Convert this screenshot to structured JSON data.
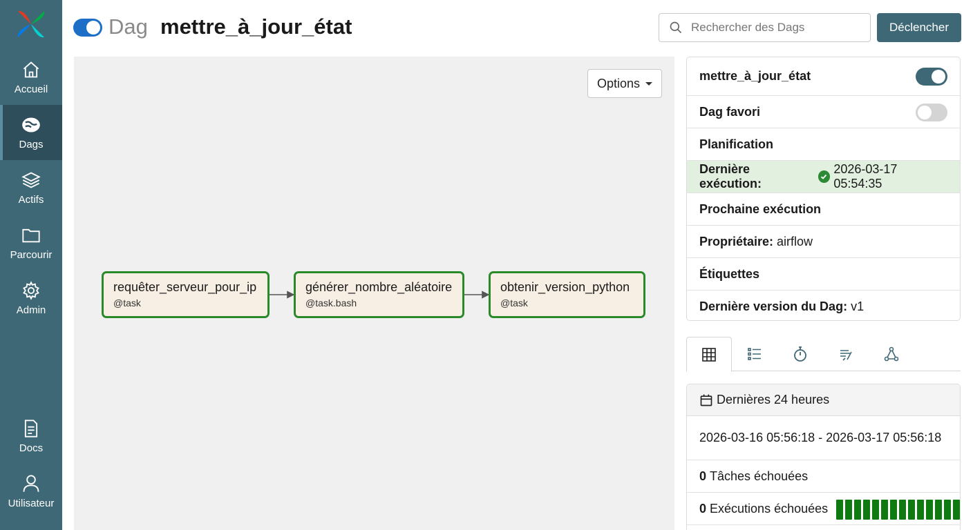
{
  "sidebar": {
    "items": [
      {
        "label": "Accueil",
        "icon": "home-icon"
      },
      {
        "label": "Dags",
        "icon": "dag-icon"
      },
      {
        "label": "Actifs",
        "icon": "layers-icon"
      },
      {
        "label": "Parcourir",
        "icon": "folder-icon"
      },
      {
        "label": "Admin",
        "icon": "gear-icon"
      },
      {
        "label": "Docs",
        "icon": "document-icon"
      },
      {
        "label": "Utilisateur",
        "icon": "user-icon"
      }
    ]
  },
  "header": {
    "kind": "Dag",
    "title": "mettre_à_jour_état",
    "search_placeholder": "Rechercher des Dags",
    "trigger_label": "Déclencher"
  },
  "graph": {
    "options_label": "Options",
    "nodes": [
      {
        "name": "requêter_serveur_pour_ip",
        "type": "@task"
      },
      {
        "name": "générer_nombre_aléatoire",
        "type": "@task.bash"
      },
      {
        "name": "obtenir_version_python",
        "type": "@task"
      }
    ]
  },
  "details": {
    "dag_name": "mettre_à_jour_état",
    "favorite_label": "Dag favori",
    "schedule_label": "Planification",
    "last_run_label": "Dernière exécution:",
    "last_run_value": "2026-03-17 05:54:35",
    "next_run_label": "Prochaine exécution",
    "owner_label": "Propriétaire:",
    "owner_value": "airflow",
    "tags_label": "Étiquettes",
    "version_label": "Dernière version du Dag:",
    "version_value": "v1"
  },
  "stats": {
    "period_label": "Dernières 24 heures",
    "range": "2026-03-16 05:56:18 - 2026-03-17 05:56:18",
    "failed_tasks_count": "0",
    "failed_tasks_label": "Tâches échouées",
    "failed_runs_count": "0",
    "failed_runs_label": "Exécutions échouées",
    "run_bars": 16
  },
  "colors": {
    "sidebar": "#3f6877",
    "accent": "#3f6877",
    "success": "#2a8a2a",
    "success_bg": "#e2f1df"
  }
}
